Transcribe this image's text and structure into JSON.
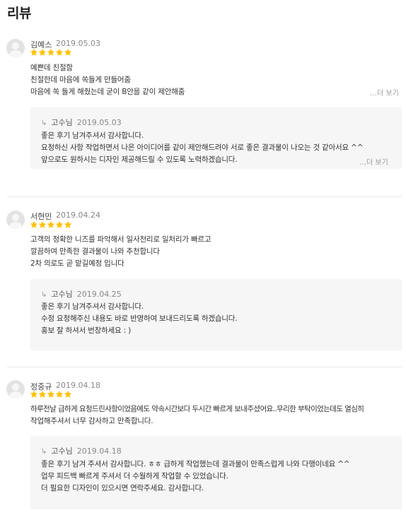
{
  "page": {
    "title": "리뷰"
  },
  "colors": {
    "star": "#ffc107",
    "reply_bg": "#f6f6f6"
  },
  "reviews": [
    {
      "name": "김예스",
      "date": "2019.05.03",
      "rating": 5,
      "lines": [
        "예쁜데 친절함",
        "친절한데 마음에 쏙들게 만들어줌",
        "마음에 쏙 들게 해줬는데 굳이 B안을 같이 제안해줌"
      ],
      "more_label": "…더 보기",
      "reply": {
        "author": "고수님",
        "date": "2019.05.03",
        "lines": [
          "좋은 후기 남겨주셔서 감사합니다.",
          "요청하신 사항 작업하면서 나온 아이디어를 같이 제안해드려야 서로 좋은 결과물이 나오는 것 같아서요 ^^",
          "앞으로도 원하시는 디자인 제공해드릴 수 있도록 노력하겠습니다."
        ],
        "more_label": "…더 보기"
      }
    },
    {
      "name": "서현민",
      "date": "2019.04.24",
      "rating": 5,
      "lines": [
        "고객의 정확한 니즈를 파악해서 일사천리로 일처리가 빠르고",
        "깔끔하여 만족한 결과물이 나와 추천합니다",
        "2차 의로도 곧 맡길예정 입니다"
      ],
      "reply": {
        "author": "고수님",
        "date": "2019.04.25",
        "lines": [
          "좋은 후기 남겨주셔서 감사합니다.",
          "수정 요청해주신 내용도 바로 반영하여 보내드리도록 하겠습니다.",
          "홍보 잘 하셔서 번창하세요 : )"
        ]
      }
    },
    {
      "name": "정중규",
      "date": "2019.04.18",
      "rating": 5,
      "lines": [
        "하루전날 급하게 요청드린사항이었음에도 약속시간보다 두시간 빠르게 보내주셨어요..무리한 부탁이었는데도 열심히",
        "작업해주셔서 너무 감사하고 만족합니다."
      ],
      "reply": {
        "author": "고수님",
        "date": "2019.04.18",
        "lines": [
          "좋은 후기 남겨 주셔서 감사합니다. ㅎㅎ 급하게 작업했는데 결과물이 만족스럽게 나와 다행이네요 ^^",
          "업무 피드백 빠르게 주셔서 더 수월하게 작업할 수 있었습니다.",
          "더 필요한 디자인이 있으시면 연락주세요. 감사합니다."
        ]
      }
    }
  ]
}
